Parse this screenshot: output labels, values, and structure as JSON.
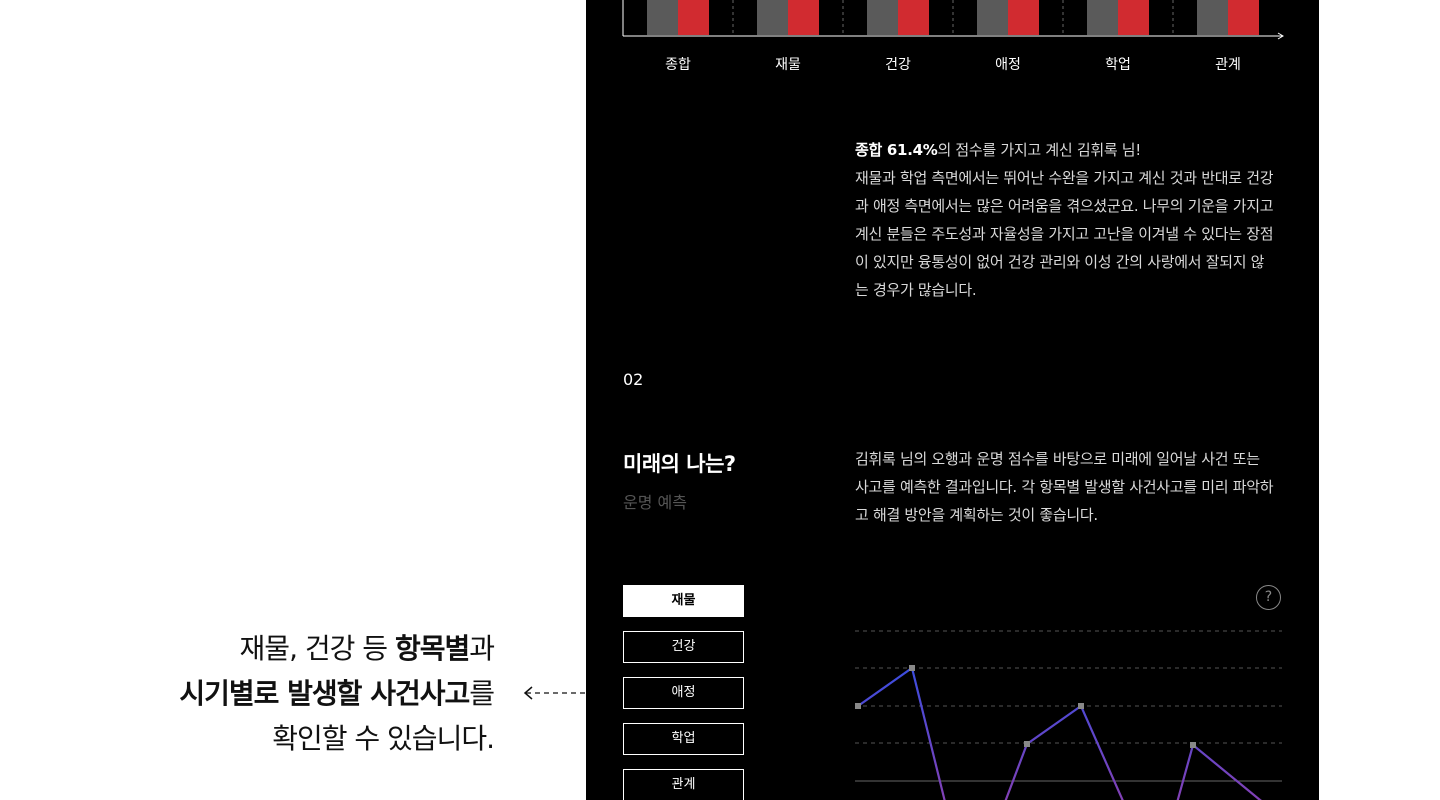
{
  "annotation": {
    "line1_pre": "재물, 건강 등 ",
    "line1_bold": "항목별",
    "line1_post": "과",
    "line2_bold": "시기별로 발생할 사건사고",
    "line2_post": "를",
    "line3": "확인할 수 있습니다."
  },
  "bar_chart": {
    "categories": [
      "종합",
      "재물",
      "건강",
      "애정",
      "학업",
      "관계"
    ],
    "colors": {
      "series_a": "#5a5a5a",
      "series_b": "#d12b30",
      "axis": "#ffffff"
    }
  },
  "summary": {
    "highlight": "종합 61.4%",
    "text_after_highlight": "의 점수를 가지고 계신 김휘록 님!",
    "body": "재물과 학업 측면에서는 뛰어난 수완을 가지고 계신 것과 반대로 건강과 애정 측면에서는 많은 어려움을 겪으셨군요. 나무의 기운을 가지고 계신 분들은 주도성과 자율성을 가지고 고난을 이겨낼 수 있다는 장점이 있지만 융통성이 없어 건강 관리와 이성 간의 사랑에서 잘되지 않는 경우가 많습니다."
  },
  "section": {
    "number": "02",
    "title": "미래의 나는?",
    "subtitle": "운명 예측",
    "description": "김휘록 님의 오행과 운명 점수를 바탕으로 미래에 일어날 사건 또는 사고를 예측한 결과입니다. 각 항목별 발생할 사건사고를 미리 파악하고 해결 방안을 계획하는 것이 좋습니다."
  },
  "category_buttons": [
    {
      "label": "재물",
      "active": true
    },
    {
      "label": "건강",
      "active": false
    },
    {
      "label": "애정",
      "active": false
    },
    {
      "label": "학업",
      "active": false
    },
    {
      "label": "관계",
      "active": false
    }
  ],
  "help_icon": {
    "icon": "question-circle-icon",
    "glyph": "?"
  },
  "line_chart": {
    "colors": {
      "start": "#3b4de0",
      "end": "#8a3fb0",
      "grid": "#555555",
      "marker": "#888888"
    }
  }
}
